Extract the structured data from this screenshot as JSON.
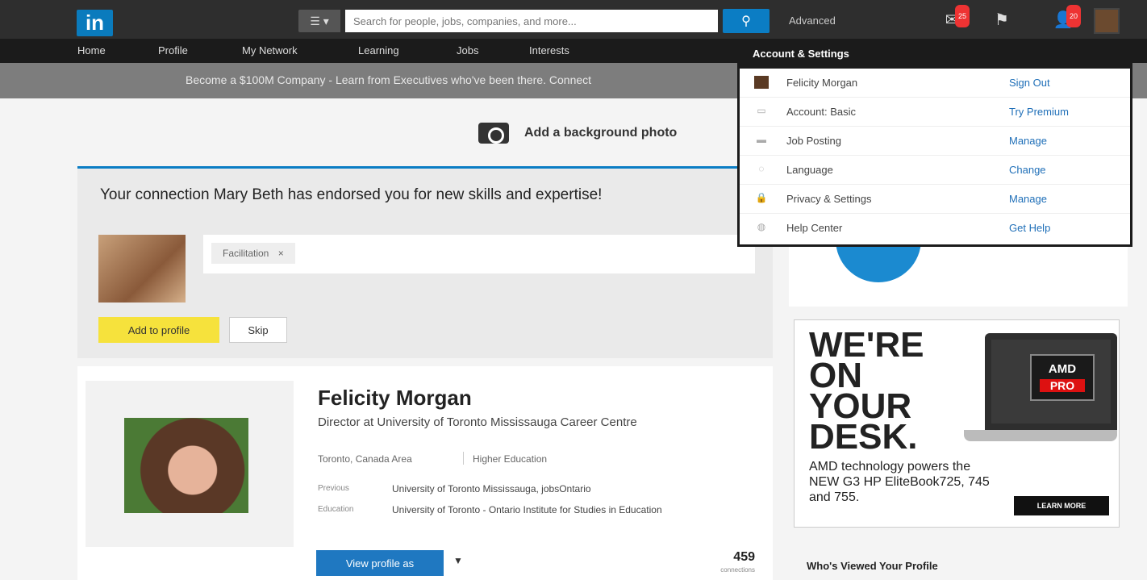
{
  "header": {
    "logo": "in",
    "search_type_icon": "list-icon",
    "search_placeholder": "Search for people, jobs, companies, and more...",
    "search_button_icon": "search-icon",
    "advanced": "Advanced",
    "icons": [
      "messages-icon",
      "flag-icon",
      "add-connection-icon"
    ],
    "badges": {
      "messages": "25",
      "connections": "20"
    }
  },
  "nav": {
    "items": [
      "Home",
      "Profile",
      "My Network",
      "Learning",
      "Jobs",
      "Interests"
    ]
  },
  "banner": {
    "text": "Become a $100M Company - Learn from Executives who've been there. Connect"
  },
  "background_photo": {
    "label": "Add a background photo"
  },
  "endorsement": {
    "title": "Your connection Mary Beth has endorsed you for new skills and expertise!",
    "skill": "Facilitation",
    "skill_remove": "×",
    "add_label": "Add to profile",
    "skip_label": "Skip"
  },
  "profile": {
    "name": "Felicity Morgan",
    "headline": "Director at University of Toronto Mississauga Career Centre",
    "location": "Toronto, Canada Area",
    "industry": "Higher Education",
    "previous_label": "Previous",
    "previous_value": "University of Toronto Mississauga, jobsOntario",
    "education_label": "Education",
    "education_value": "University of Toronto - Ontario Institute for Studies in Education",
    "view_profile_as": "View profile as",
    "connections_count": "459",
    "connections_label": "connections"
  },
  "ad": {
    "headline": "WE'RE ON YOUR DESK.",
    "badge_top": "AMD",
    "badge_pro": "PRO",
    "copy": "AMD technology powers the NEW G3 HP EliteBook725, 745 and 755.",
    "cta": "LEARN MORE"
  },
  "sidebar": {
    "who_viewed": "Who's Viewed Your Profile"
  },
  "dropdown": {
    "title": "Account & Settings",
    "rows": [
      {
        "label": "Felicity Morgan",
        "action": "Sign Out",
        "icon": "avatar-icon"
      },
      {
        "label": "Account: Basic",
        "action": "Try Premium",
        "icon": "account-icon"
      },
      {
        "label": "Job Posting",
        "action": "Manage",
        "icon": "briefcase-icon"
      },
      {
        "label": "Language",
        "action": "Change",
        "icon": "language-icon"
      },
      {
        "label": "Privacy & Settings",
        "action": "Manage",
        "icon": "lock-icon"
      },
      {
        "label": "Help Center",
        "action": "Get Help",
        "icon": "help-icon"
      }
    ]
  },
  "colors": {
    "brand": "#0a7bbd",
    "topbar": "#2e2e2e",
    "subnav": "#1b1b1b",
    "link": "#1f6fb8",
    "add_button": "#f6e23c"
  }
}
